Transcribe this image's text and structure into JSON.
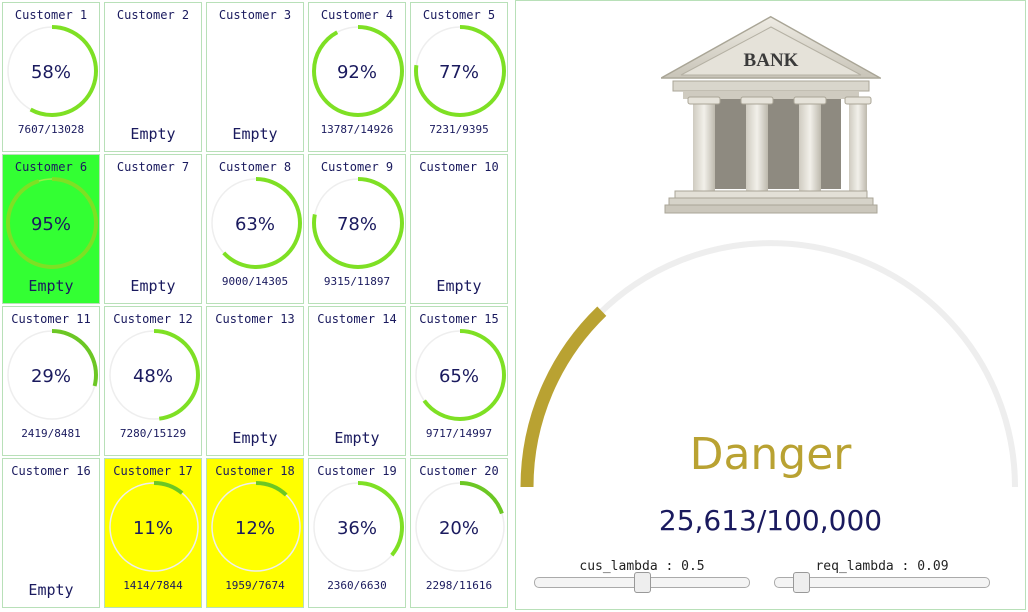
{
  "customers": [
    {
      "label": "Customer 1",
      "pct": 58,
      "pct_text": "58%",
      "count": "7607/13028",
      "empty": false,
      "highlight": "none"
    },
    {
      "label": "Customer 2",
      "empty": true,
      "empty_text": "Empty",
      "highlight": "none"
    },
    {
      "label": "Customer 3",
      "empty": true,
      "empty_text": "Empty",
      "highlight": "none"
    },
    {
      "label": "Customer 4",
      "pct": 92,
      "pct_text": "92%",
      "count": "13787/14926",
      "empty": false,
      "highlight": "none"
    },
    {
      "label": "Customer 5",
      "pct": 77,
      "pct_text": "77%",
      "count": "7231/9395",
      "empty": false,
      "highlight": "none"
    },
    {
      "label": "Customer 6",
      "pct": 95,
      "pct_text": "95%",
      "empty": false,
      "empty_text": "Empty",
      "highlight": "green"
    },
    {
      "label": "Customer 7",
      "empty": true,
      "empty_text": "Empty",
      "highlight": "none"
    },
    {
      "label": "Customer 8",
      "pct": 63,
      "pct_text": "63%",
      "count": "9000/14305",
      "empty": false,
      "highlight": "none"
    },
    {
      "label": "Customer 9",
      "pct": 78,
      "pct_text": "78%",
      "count": "9315/11897",
      "empty": false,
      "highlight": "none"
    },
    {
      "label": "Customer 10",
      "empty": true,
      "empty_text": "Empty",
      "highlight": "none"
    },
    {
      "label": "Customer 11",
      "pct": 29,
      "pct_text": "29%",
      "count": "2419/8481",
      "empty": false,
      "highlight": "none"
    },
    {
      "label": "Customer 12",
      "pct": 48,
      "pct_text": "48%",
      "count": "7280/15129",
      "empty": false,
      "highlight": "none"
    },
    {
      "label": "Customer 13",
      "empty": true,
      "empty_text": "Empty",
      "highlight": "none"
    },
    {
      "label": "Customer 14",
      "empty": true,
      "empty_text": "Empty",
      "highlight": "none"
    },
    {
      "label": "Customer 15",
      "pct": 65,
      "pct_text": "65%",
      "count": "9717/14997",
      "empty": false,
      "highlight": "none"
    },
    {
      "label": "Customer 16",
      "empty": true,
      "empty_text": "Empty",
      "highlight": "none"
    },
    {
      "label": "Customer 17",
      "pct": 11,
      "pct_text": "11%",
      "count": "1414/7844",
      "empty": false,
      "highlight": "yellow"
    },
    {
      "label": "Customer 18",
      "pct": 12,
      "pct_text": "12%",
      "count": "1959/7674",
      "empty": false,
      "highlight": "yellow"
    },
    {
      "label": "Customer 19",
      "pct": 36,
      "pct_text": "36%",
      "count": "2360/6630",
      "empty": false,
      "highlight": "none"
    },
    {
      "label": "Customer 20",
      "pct": 20,
      "pct_text": "20%",
      "count": "2298/11616",
      "empty": false,
      "highlight": "none"
    }
  ],
  "bank": {
    "sign": "BANK",
    "icon": "bank-building-icon",
    "status": "Danger",
    "total": "25,613/100,000",
    "gauge_fraction": 0.25613
  },
  "sliders": [
    {
      "label": "cus_lambda : 0.5",
      "fraction": 0.5
    },
    {
      "label": "req_lambda : 0.09",
      "fraction": 0.09
    }
  ],
  "colors": {
    "ring": "#7ee024",
    "ring_low": "#6cc724",
    "ring_track": "#eeeeee",
    "green_cell": "#33ff33",
    "yellow_cell": "#ffff00",
    "gauge": "#b9a232",
    "gauge_track": "#eeeeee",
    "text": "#1a1a5e"
  }
}
